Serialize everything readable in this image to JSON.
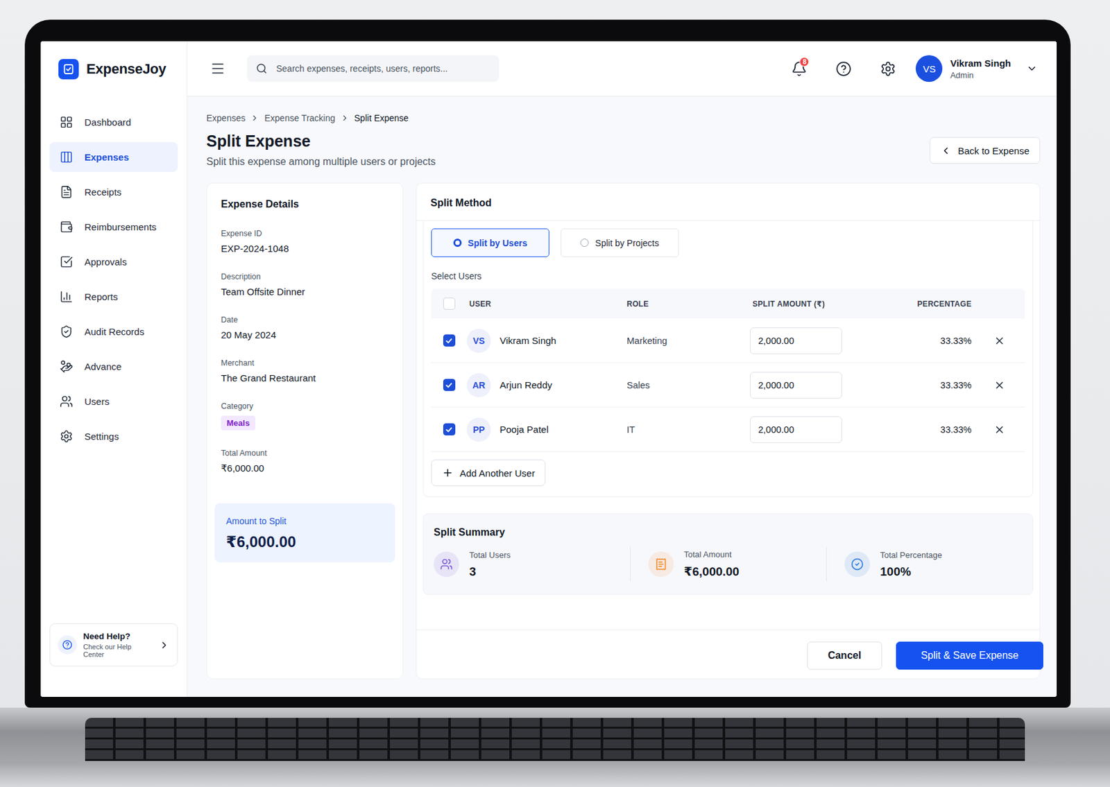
{
  "app": {
    "name": "ExpenseJoy"
  },
  "search": {
    "placeholder": "Search expenses, receipts, users, reports..."
  },
  "notifications": {
    "count": "8"
  },
  "user": {
    "initials": "VS",
    "name": "Vikram Singh",
    "role": "Admin"
  },
  "sidebar": {
    "items": [
      {
        "label": "Dashboard",
        "selected": false
      },
      {
        "label": "Expenses",
        "selected": true
      },
      {
        "label": "Receipts",
        "selected": false
      },
      {
        "label": "Reimbursements",
        "selected": false
      },
      {
        "label": "Approvals",
        "selected": false
      },
      {
        "label": "Reports",
        "selected": false
      },
      {
        "label": "Audit Records",
        "selected": false
      },
      {
        "label": "Advance",
        "selected": false
      },
      {
        "label": "Users",
        "selected": false
      },
      {
        "label": "Settings",
        "selected": false
      }
    ],
    "help": {
      "title": "Need Help?",
      "subtitle": "Check our Help Center"
    }
  },
  "breadcrumbs": [
    "Expenses",
    "Expense Tracking",
    "Split Expense"
  ],
  "page": {
    "title": "Split Expense",
    "subtitle": "Split this expense among multiple users or projects",
    "back_button": "Back to Expense"
  },
  "expense_details": {
    "title": "Expense Details",
    "fields": [
      {
        "label": "Expense ID",
        "value": "EXP-2024-1048",
        "kind": "text"
      },
      {
        "label": "Description",
        "value": "Team Offsite Dinner",
        "kind": "text"
      },
      {
        "label": "Date",
        "value": "20 May 2024",
        "kind": "text"
      },
      {
        "label": "Merchant",
        "value": "The Grand Restaurant",
        "kind": "text"
      },
      {
        "label": "Category",
        "value": "Meals",
        "kind": "tag"
      },
      {
        "label": "Total Amount",
        "value": "₹6,000.00",
        "kind": "text"
      }
    ],
    "amount_to_split": {
      "label": "Amount to Split",
      "value": "₹6,000.00"
    }
  },
  "split_method": {
    "title": "Split Method",
    "options": [
      {
        "label": "Split by Users",
        "selected": true
      },
      {
        "label": "Split by Projects",
        "selected": false
      }
    ],
    "select_label": "Select Users"
  },
  "table": {
    "select_all_checked": false,
    "columns": [
      "USER",
      "ROLE",
      "SPLIT AMOUNT (₹)",
      "PERCENTAGE"
    ],
    "rows": [
      {
        "initials": "VS",
        "name": "Vikram Singh",
        "role": "Marketing",
        "amount": "2,000.00",
        "percentage": "33.33%",
        "checked": true
      },
      {
        "initials": "AR",
        "name": "Arjun Reddy",
        "role": "Sales",
        "amount": "2,000.00",
        "percentage": "33.33%",
        "checked": true
      },
      {
        "initials": "PP",
        "name": "Pooja Patel",
        "role": "IT",
        "amount": "2,000.00",
        "percentage": "33.33%",
        "checked": true
      }
    ],
    "add_button": "Add Another User"
  },
  "summary": {
    "title": "Split Summary",
    "stats": [
      {
        "label": "Total Users",
        "value": "3",
        "color": "#7c5cdb"
      },
      {
        "label": "Total Amount",
        "value": "₹6,000.00",
        "color": "#f08c2e"
      },
      {
        "label": "Total Percentage",
        "value": "100%",
        "color": "#2f7de1"
      }
    ]
  },
  "buttons": [
    {
      "label": "Cancel",
      "primary": false
    },
    {
      "label": "Split & Save Expense",
      "primary": true
    }
  ]
}
